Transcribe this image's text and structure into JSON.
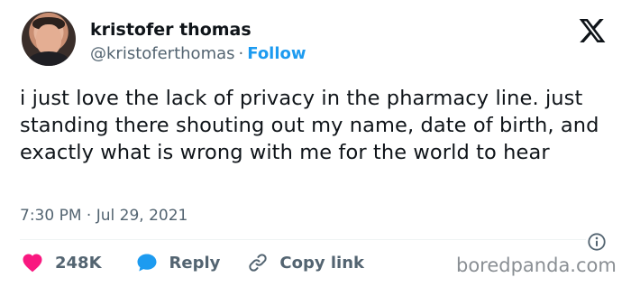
{
  "author": {
    "name": "kristofer thomas",
    "handle": "@kristoferthomas",
    "separator": "·",
    "follow_label": "Follow"
  },
  "tweet": {
    "text": "i just love the lack of privacy in the pharmacy line. just standing there shouting out my name, date of birth, and exactly what is wrong with me for the world to hear",
    "time": "7:30 PM",
    "separator": "·",
    "date": "Jul 29, 2021"
  },
  "actions": {
    "like_count": "248K",
    "reply_label": "Reply",
    "copy_link_label": "Copy link"
  },
  "watermark": "boredpanda.com",
  "icons": {
    "platform": "x-logo-icon",
    "info": "info-icon",
    "like": "heart-icon",
    "reply": "speech-bubble-icon",
    "copy": "link-icon"
  },
  "colors": {
    "text": "#0f1419",
    "secondary": "#536471",
    "follow": "#1d9bf0",
    "heart": "#f91880",
    "reply_bubble": "#1d9bf0"
  }
}
